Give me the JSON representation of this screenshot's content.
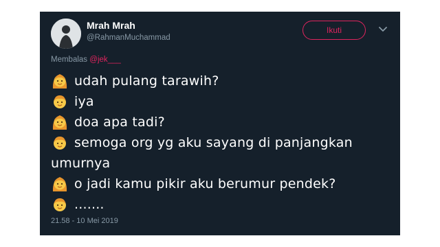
{
  "tweet": {
    "display_name": "Mrah Mrah",
    "handle": "@RahmanMuchammad",
    "follow_label": "Ikuti",
    "reply_prefix": "Membalas",
    "reply_mention": "@jek___",
    "lines": [
      {
        "speaker": "girl",
        "text": "udah pulang tarawih?"
      },
      {
        "speaker": "boy",
        "text": "iya"
      },
      {
        "speaker": "girl",
        "text": "doa apa tadi?"
      },
      {
        "speaker": "boy",
        "text": "semoga org yg aku sayang di panjangkan"
      },
      {
        "speaker": "none",
        "text": "umurnya"
      },
      {
        "speaker": "girl",
        "text": "o jadi kamu pikir aku berumur pendek?"
      },
      {
        "speaker": "boy",
        "text": "......."
      }
    ],
    "timestamp": "21.58 - 10 Mei 2019"
  },
  "icons": {
    "girl": "girl-emoji-icon",
    "boy": "boy-emoji-icon",
    "more": "chevron-down-icon"
  },
  "colors": {
    "background": "#15202b",
    "accent": "#e0245e",
    "secondary_text": "#8899a6",
    "emoji_skin": "#f7c948",
    "emoji_hair": "#e8952c"
  }
}
